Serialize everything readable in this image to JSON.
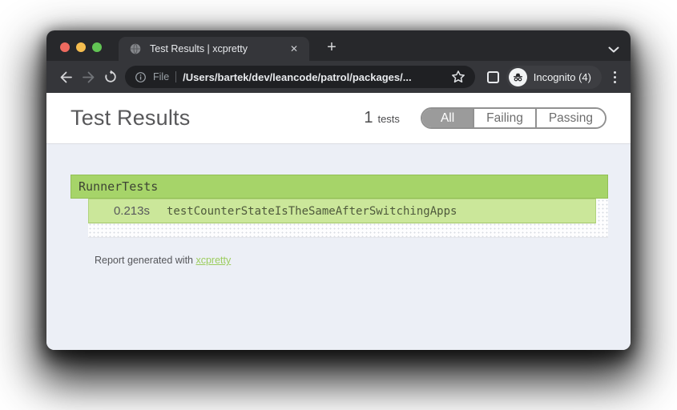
{
  "browser": {
    "tab_title": "Test Results | xcpretty",
    "icons": {
      "close_tab": "✕",
      "new_tab": "+",
      "menu": "kebab-dots",
      "favicon": "globe",
      "bookmark": "star-outline",
      "info": "circle-i"
    },
    "nav": {
      "url_scheme_label": "File",
      "url_path": "/Users/bartek/dev/leancode/patrol/packages/...",
      "incognito_label": "Incognito (4)"
    }
  },
  "page": {
    "title": "Test Results",
    "test_count": "1",
    "test_count_unit": "tests",
    "filters": [
      {
        "label": "All",
        "active": true
      },
      {
        "label": "Failing",
        "active": false
      },
      {
        "label": "Passing",
        "active": false
      }
    ],
    "suite": {
      "name": "RunnerTests",
      "test": {
        "duration": "0.213s",
        "name": "testCounterStateIsTheSameAfterSwitchingApps",
        "status": "passing"
      }
    },
    "footer_text": "Report generated with",
    "footer_link": "xcpretty"
  },
  "colors": {
    "traffic_red": "#ee6a5f",
    "traffic_yellow": "#f5bd4f",
    "traffic_green": "#62c454",
    "suite_header_bg": "#a6d469",
    "test_row_bg": "#cbe79a",
    "link_green": "#9ccd5e",
    "frame_bg": "#27282b",
    "toolbar_bg": "#35363a",
    "omnibox_bg": "#1f2023",
    "page_bg": "#eceff6"
  }
}
